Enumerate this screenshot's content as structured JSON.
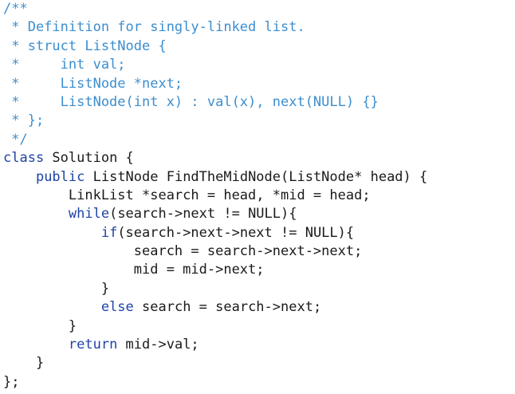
{
  "colors": {
    "background": "#ffffff",
    "comment": "#3c8ecf",
    "keyword": "#1f43a6",
    "text": "#1a1a1a"
  },
  "code_lines": [
    [
      {
        "t": "/**",
        "k": "comment"
      }
    ],
    [
      {
        "t": " * Definition for singly-linked list.",
        "k": "comment"
      }
    ],
    [
      {
        "t": " * struct ListNode {",
        "k": "comment"
      }
    ],
    [
      {
        "t": " *     int val;",
        "k": "comment"
      }
    ],
    [
      {
        "t": " *     ListNode *next;",
        "k": "comment"
      }
    ],
    [
      {
        "t": " *     ListNode(int x) : val(x), next(NULL) {}",
        "k": "comment"
      }
    ],
    [
      {
        "t": " * };",
        "k": "comment"
      }
    ],
    [
      {
        "t": " */",
        "k": "comment"
      }
    ],
    [
      {
        "t": "class",
        "k": "keyword"
      },
      {
        "t": " Solution {",
        "k": "text"
      }
    ],
    [
      {
        "t": "    ",
        "k": "text"
      },
      {
        "t": "public",
        "k": "keyword"
      },
      {
        "t": " ListNode FindTheMidNode(ListNode* head) {",
        "k": "text"
      }
    ],
    [
      {
        "t": "        LinkList *search = head, *mid = head;",
        "k": "text"
      }
    ],
    [
      {
        "t": "        ",
        "k": "text"
      },
      {
        "t": "while",
        "k": "keyword"
      },
      {
        "t": "(search->next != NULL){",
        "k": "text"
      }
    ],
    [
      {
        "t": "            ",
        "k": "text"
      },
      {
        "t": "if",
        "k": "keyword"
      },
      {
        "t": "(search->next->next != NULL){",
        "k": "text"
      }
    ],
    [
      {
        "t": "                search = search->next->next;",
        "k": "text"
      }
    ],
    [
      {
        "t": "                mid = mid->next;",
        "k": "text"
      }
    ],
    [
      {
        "t": "            }",
        "k": "text"
      }
    ],
    [
      {
        "t": "            ",
        "k": "text"
      },
      {
        "t": "else",
        "k": "keyword"
      },
      {
        "t": " search = search->next;",
        "k": "text"
      }
    ],
    [
      {
        "t": "        }",
        "k": "text"
      }
    ],
    [
      {
        "t": "        ",
        "k": "text"
      },
      {
        "t": "return",
        "k": "keyword"
      },
      {
        "t": " mid->val;",
        "k": "text"
      }
    ],
    [
      {
        "t": "    }",
        "k": "text"
      }
    ],
    [
      {
        "t": "};",
        "k": "text"
      }
    ]
  ]
}
